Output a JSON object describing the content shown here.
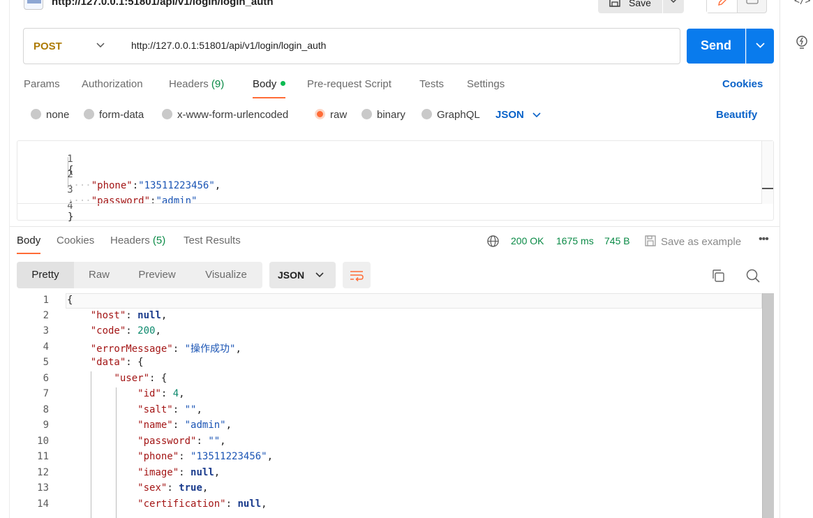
{
  "request": {
    "path_title": "http://127.0.0.1:51801/api/v1/login/login_auth",
    "save_label": "Save",
    "method": "POST",
    "url": "http://127.0.0.1:51801/api/v1/login/login_auth",
    "send_label": "Send"
  },
  "request_tabs": {
    "params": "Params",
    "authorization": "Authorization",
    "headers": "Headers",
    "headers_count": "(9)",
    "body": "Body",
    "pre_request": "Pre-request Script",
    "tests": "Tests",
    "settings": "Settings",
    "cookies": "Cookies"
  },
  "body_options": {
    "none": "none",
    "form_data": "form-data",
    "urlencoded": "x-www-form-urlencoded",
    "raw": "raw",
    "binary": "binary",
    "graphql": "GraphQL",
    "format": "JSON",
    "beautify": "Beautify",
    "selected": "raw"
  },
  "request_body": {
    "line_numbers": [
      "1",
      "2",
      "3",
      "4"
    ],
    "open": "{",
    "close": "}",
    "k1": "\"phone\"",
    "v1": "\"13511223456\"",
    "k2": "\"password\"",
    "v2": "\"admin\""
  },
  "response_tabs": {
    "body": "Body",
    "cookies": "Cookies",
    "headers": "Headers",
    "headers_count": "(5)",
    "test_results": "Test Results"
  },
  "response_meta": {
    "status": "200 OK",
    "time": "1675 ms",
    "size": "745 B",
    "save_example": "Save as example"
  },
  "view_modes": {
    "pretty": "Pretty",
    "raw": "Raw",
    "preview": "Preview",
    "visualize": "Visualize",
    "format": "JSON"
  },
  "response_body": {
    "line_numbers": [
      "1",
      "2",
      "3",
      "4",
      "5",
      "6",
      "7",
      "8",
      "9",
      "10",
      "11",
      "12",
      "13",
      "14"
    ],
    "l1": "{",
    "k_host": "\"host\"",
    "v_host": "null",
    "k_code": "\"code\"",
    "v_code": "200",
    "k_err": "\"errorMessage\"",
    "v_err": "\"操作成功\"",
    "k_data": "\"data\"",
    "data_open": "{",
    "k_user": "\"user\"",
    "user_open": "{",
    "k_id": "\"id\"",
    "v_id": "4",
    "k_salt": "\"salt\"",
    "v_salt": "\"\"",
    "k_name": "\"name\"",
    "v_name": "\"admin\"",
    "k_password": "\"password\"",
    "v_password": "\"\"",
    "k_phone": "\"phone\"",
    "v_phone": "\"13511223456\"",
    "k_image": "\"image\"",
    "v_image": "null",
    "k_sex": "\"sex\"",
    "v_sex": "true",
    "k_cert": "\"certification\"",
    "v_cert": "null"
  },
  "colors": {
    "accent_orange": "#ff6c37",
    "send_blue": "#097bed",
    "link_blue": "#0a63c9",
    "status_green": "#0a8a46",
    "method_post": "#ad7a03"
  }
}
